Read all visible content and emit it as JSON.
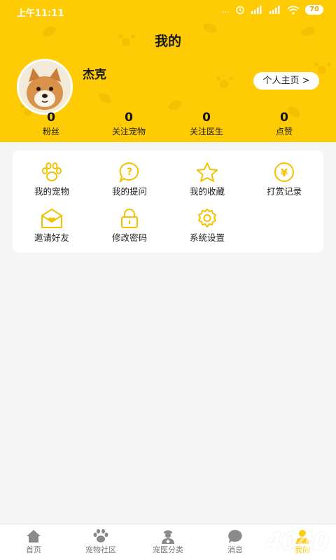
{
  "status_bar": {
    "time": "上午11:11",
    "signal_dots": "...",
    "battery": "70"
  },
  "header": {
    "title": "我的"
  },
  "profile": {
    "username": "杰克",
    "homepage_button": "个人主页 >"
  },
  "stats": [
    {
      "value": "0",
      "label": "粉丝"
    },
    {
      "value": "0",
      "label": "关注宠物"
    },
    {
      "value": "0",
      "label": "关注医生"
    },
    {
      "value": "0",
      "label": "点赞"
    }
  ],
  "menu": [
    {
      "label": "我的宠物",
      "icon": "paw-icon"
    },
    {
      "label": "我的提问",
      "icon": "question-icon"
    },
    {
      "label": "我的收藏",
      "icon": "star-icon"
    },
    {
      "label": "打赏记录",
      "icon": "yen-icon"
    },
    {
      "label": "邀请好友",
      "icon": "invite-envelope-icon"
    },
    {
      "label": "修改密码",
      "icon": "lock-icon"
    },
    {
      "label": "系统设置",
      "icon": "gear-icon"
    }
  ],
  "tabbar": [
    {
      "label": "首页",
      "icon": "home-icon"
    },
    {
      "label": "宠物社区",
      "icon": "paw-icon"
    },
    {
      "label": "宠医分类",
      "icon": "doctor-icon"
    },
    {
      "label": "消息",
      "icon": "message-icon"
    },
    {
      "label": "我的",
      "icon": "profile-icon"
    }
  ],
  "watermark": "4040",
  "colors": {
    "brand_yellow": "#ffcb05",
    "icon_yellow": "#f2c200"
  }
}
